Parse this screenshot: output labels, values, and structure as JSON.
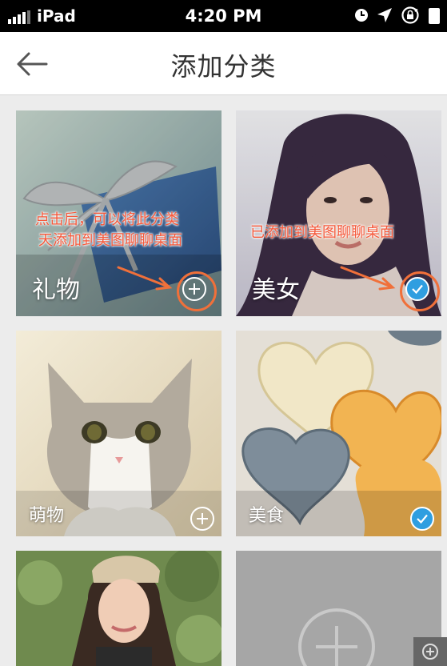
{
  "status_bar": {
    "carrier": "iPad",
    "time": "4:20 PM",
    "icons": [
      "alarm-clock-icon",
      "location-arrow-icon",
      "rotation-lock-icon"
    ]
  },
  "nav": {
    "back_icon": "back-arrow-icon",
    "title": "添加分类"
  },
  "categories": [
    {
      "label": "礼物",
      "state": "add",
      "image": "gift box with silver ribbon",
      "annotation": [
        "点击后，可以将此分类",
        "天添加到美图聊聊桌面"
      ]
    },
    {
      "label": "美女",
      "state": "added",
      "image": "portrait of a woman",
      "annotation": [
        "已添加到美图聊聊桌面"
      ]
    },
    {
      "label": "萌物",
      "state": "add",
      "image": "kitten"
    },
    {
      "label": "美食",
      "state": "added",
      "image": "heart-shaped cookies"
    },
    {
      "label": "",
      "state": "none",
      "image": "woman in beanie"
    },
    {
      "label": "",
      "state": "add-more",
      "image": ""
    }
  ],
  "colors": {
    "annotation": "#f5583a",
    "check_blue": "#2f9ee0",
    "placeholder_gray": "#a6a6a6"
  }
}
